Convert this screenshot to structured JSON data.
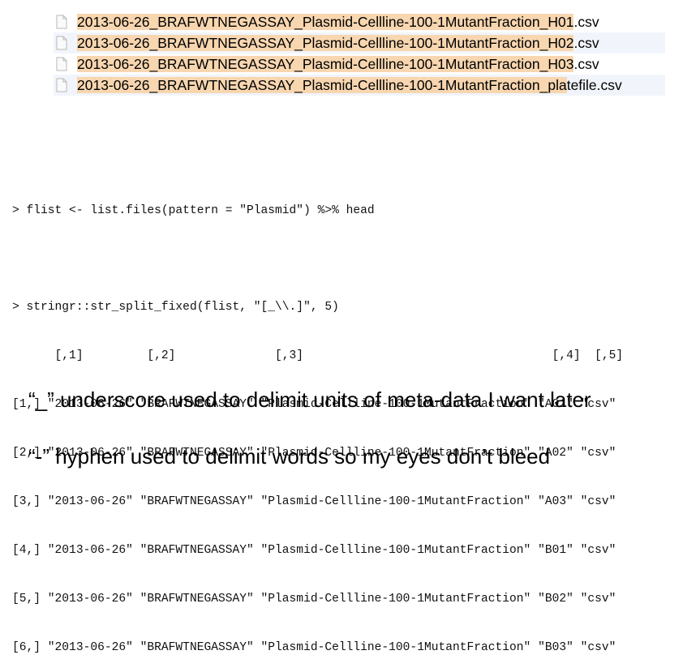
{
  "files": [
    {
      "highlight": "2013-06-26_BRAFWTNEGASSAY_Plasmid-Cellline-100-1MutantFraction_H01",
      "rest": ".csv"
    },
    {
      "highlight": "2013-06-26_BRAFWTNEGASSAY_Plasmid-Cellline-100-1MutantFraction_H02",
      "rest": ".csv"
    },
    {
      "highlight": "2013-06-26_BRAFWTNEGASSAY_Plasmid-Cellline-100-1MutantFraction_H03",
      "rest": ".csv"
    },
    {
      "highlight": "2013-06-26_BRAFWTNEGASSAY_Plasmid-Cellline-100-1MutantFraction_pla",
      "rest": "tefile.csv"
    }
  ],
  "console": {
    "cmd1": "> flist <- list.files(pattern = \"Plasmid\") %>% head",
    "cmd2": "> stringr::str_split_fixed(flist, \"[_\\\\.]\", 5)",
    "header": "      [,1]         [,2]              [,3]                                   [,4]  [,5]",
    "rows": [
      "[1,] \"2013-06-26\" \"BRAFWTNEGASSAY\" \"Plasmid-Cellline-100-1MutantFraction\" \"A01\" \"csv\"",
      "[2,] \"2013-06-26\" \"BRAFWTNEGASSAY\" \"Plasmid-Cellline-100-1MutantFraction\" \"A02\" \"csv\"",
      "[3,] \"2013-06-26\" \"BRAFWTNEGASSAY\" \"Plasmid-Cellline-100-1MutantFraction\" \"A03\" \"csv\"",
      "[4,] \"2013-06-26\" \"BRAFWTNEGASSAY\" \"Plasmid-Cellline-100-1MutantFraction\" \"B01\" \"csv\"",
      "[5,] \"2013-06-26\" \"BRAFWTNEGASSAY\" \"Plasmid-Cellline-100-1MutantFraction\" \"B02\" \"csv\"",
      "[6,] \"2013-06-26\" \"BRAFWTNEGASSAY\" \"Plasmid-Cellline-100-1MutantFraction\" \"B03\" \"csv\""
    ]
  },
  "notes": {
    "underscore": "“_” underscore used to delimit units of meta-data I want later",
    "hyphen": "“-” hyphen used to delimit words so my eyes don’t bleed"
  },
  "colors": {
    "highlight": "#f7d6b0",
    "row_alt": "#f1f5fb"
  },
  "icons": {
    "file": "document-icon"
  }
}
